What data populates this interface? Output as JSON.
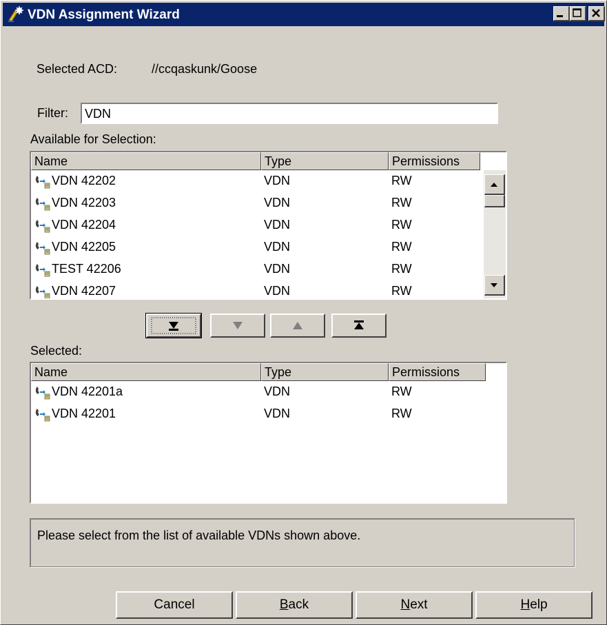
{
  "window": {
    "title": "VDN Assignment Wizard"
  },
  "acd": {
    "label": "Selected ACD:",
    "value": "//ccqaskunk/Goose"
  },
  "filter": {
    "label": "Filter:",
    "value": "VDN"
  },
  "available": {
    "label": "Available for Selection:",
    "columns": [
      "Name",
      "Type",
      "Permissions"
    ],
    "rows": [
      {
        "name": "VDN 42202",
        "type": "VDN",
        "perm": "RW"
      },
      {
        "name": "VDN 42203",
        "type": "VDN",
        "perm": "RW"
      },
      {
        "name": "VDN 42204",
        "type": "VDN",
        "perm": "RW"
      },
      {
        "name": "VDN 42205",
        "type": "VDN",
        "perm": "RW"
      },
      {
        "name": "TEST 42206",
        "type": "VDN",
        "perm": "RW"
      },
      {
        "name": "VDN 42207",
        "type": "VDN",
        "perm": "RW"
      }
    ]
  },
  "move_buttons": [
    "move-all-down-icon",
    "move-down-icon",
    "move-up-icon",
    "move-all-up-icon"
  ],
  "selected": {
    "label": "Selected:",
    "columns": [
      "Name",
      "Type",
      "Permissions"
    ],
    "rows": [
      {
        "name": "VDN 42201a",
        "type": "VDN",
        "perm": "RW"
      },
      {
        "name": "VDN 42201",
        "type": "VDN",
        "perm": "RW"
      }
    ]
  },
  "status": "Please select from the list of available VDNs shown above.",
  "buttons": {
    "cancel": "Cancel",
    "back": "Back",
    "next": "Next",
    "help": "Help"
  },
  "colors": {
    "face": "#d4d0c8",
    "titlebar": "#0a246a",
    "text": "#000000"
  }
}
